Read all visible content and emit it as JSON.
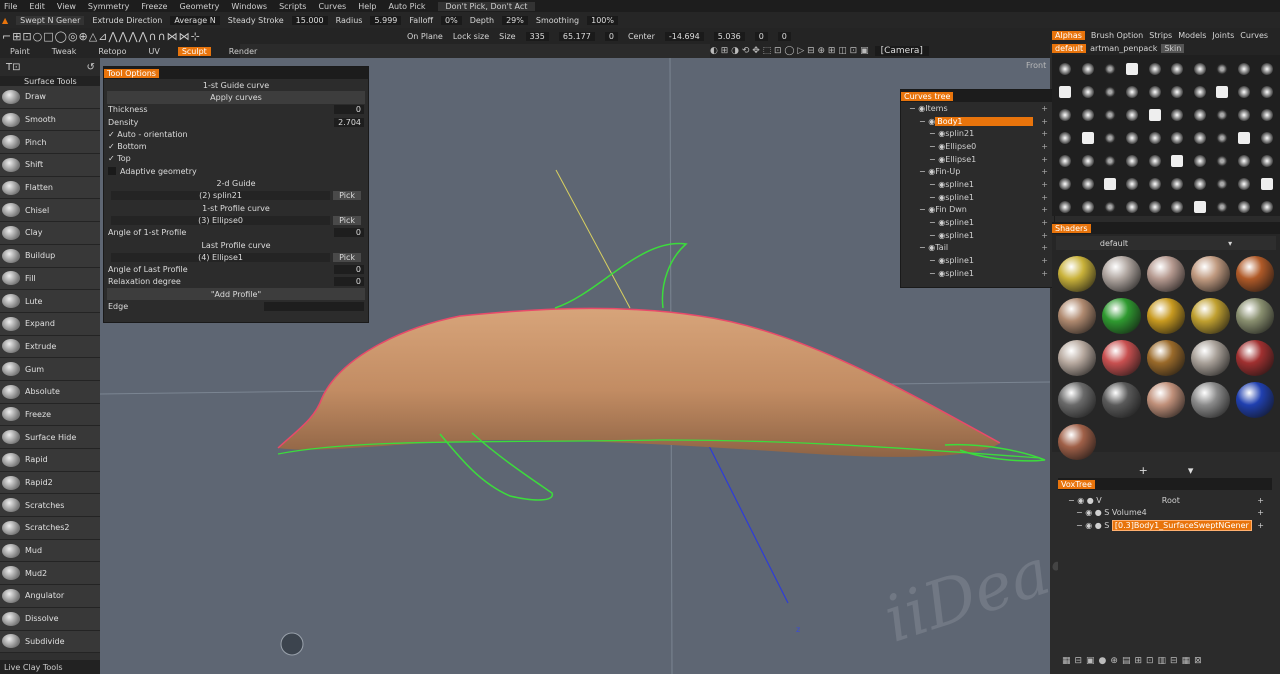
{
  "menu": [
    "File",
    "Edit",
    "View",
    "Symmetry",
    "Freeze",
    "Geometry",
    "Windows",
    "Scripts",
    "Curves",
    "Help",
    "Auto Pick",
    "Don't Pick, Don't Act"
  ],
  "options": {
    "mode": "Swept N Gener",
    "extrude_label": "Extrude Direction",
    "extrude_value": "Average N",
    "steady_label": "Steady Stroke",
    "steady_value": "15.000",
    "radius_label": "Radius",
    "radius_value": "5.999",
    "falloff_label": "Falloff",
    "falloff_value": "0%",
    "depth_label": "Depth",
    "depth_value": "29%",
    "smoothing_label": "Smoothing",
    "smoothing_value": "100%"
  },
  "iconbar": {
    "on_plane": "On Plane",
    "lock_size": "Lock size",
    "size_label": "Size",
    "size_x": "335",
    "size_y": "65.177",
    "size_z": "0",
    "center_label": "Center",
    "center_x": "-14.694",
    "center_y": "5.036",
    "center_z": "0",
    "center_a": "0",
    "camera": "[Camera]"
  },
  "mode_tabs": [
    "Paint",
    "Tweak",
    "Retopo",
    "UV",
    "Sculpt",
    "Render"
  ],
  "active_mode": "Sculpt",
  "right_tabs": [
    "Alphas",
    "Brush Option",
    "Strips",
    "Models",
    "Joints",
    "Curves"
  ],
  "right_sub": [
    "default",
    "artman_penpack",
    "Skin"
  ],
  "left_panel": {
    "title": "Surface Tools",
    "tools": [
      "Draw",
      "Smooth",
      "Pinch",
      "Shift",
      "Flatten",
      "Chisel",
      "Clay",
      "Buildup",
      "Fill",
      "Lute",
      "Expand",
      "Extrude",
      "Gum",
      "Absolute",
      "Freeze",
      "Surface Hide",
      "Rapid",
      "Rapid2",
      "Scratches",
      "Scratches2",
      "Mud",
      "Mud2",
      "Angulator",
      "Dissolve",
      "Subdivide"
    ],
    "footer": "Live Clay Tools"
  },
  "tool_options": {
    "title": "Tool Options",
    "guide1_label": "1-st Guide curve",
    "apply_button": "Apply curves",
    "thickness_label": "Thickness",
    "thickness_value": "0",
    "density_label": "Density",
    "density_value": "2.704",
    "auto_orientation": "Auto - orientation",
    "bottom": "Bottom",
    "top": "Top",
    "adaptive": "Adaptive geometry",
    "guide2_label": "2-d Guide",
    "guide2_value": "(2) splin21",
    "profile1_label": "1-st Profile curve",
    "profile1_value": "(3) Ellipse0",
    "angle1_label": "Angle of 1-st Profile",
    "angle1_value": "0",
    "last_profile_label": "Last Profile curve",
    "last_profile_value": "(4) Ellipse1",
    "angle_last_label": "Angle of Last Profile",
    "angle_last_value": "0",
    "relax_label": "Relaxation degree",
    "relax_value": "0",
    "add_profile": "\"Add Profile\"",
    "edge_label": "Edge",
    "pick": "Pick"
  },
  "curves_tree": {
    "title": "Curves tree",
    "nodes": [
      {
        "label": "Items",
        "depth": 0
      },
      {
        "label": "Body1",
        "depth": 1,
        "selected": true
      },
      {
        "label": "splin21",
        "depth": 2
      },
      {
        "label": "Ellipse0",
        "depth": 2
      },
      {
        "label": "Ellipse1",
        "depth": 2
      },
      {
        "label": "Fin-Up",
        "depth": 1
      },
      {
        "label": "spline1",
        "depth": 2
      },
      {
        "label": "spline1",
        "depth": 2
      },
      {
        "label": "Fin Dwn",
        "depth": 1
      },
      {
        "label": "spline1",
        "depth": 2
      },
      {
        "label": "spline1",
        "depth": 2
      },
      {
        "label": "Tail",
        "depth": 1
      },
      {
        "label": "spline1",
        "depth": 2
      },
      {
        "label": "spline1",
        "depth": 2
      }
    ]
  },
  "shaders": {
    "title": "Shaders",
    "preset": "default"
  },
  "voxtree": {
    "title": "VoxTree",
    "root": "Root",
    "volume": "Volume4",
    "selected": "[0.3]Body1_SurfaceSweptNGener"
  },
  "viewport": {
    "view_label": "Front",
    "axis_z": "z"
  },
  "watermark": "iiDea·CN",
  "colors": {
    "accent": "#e8740c",
    "viewport_bg": "#5e6673",
    "body": "#c8966d",
    "curve_green": "#3cdc3c",
    "curve_red": "#e84a6a"
  }
}
